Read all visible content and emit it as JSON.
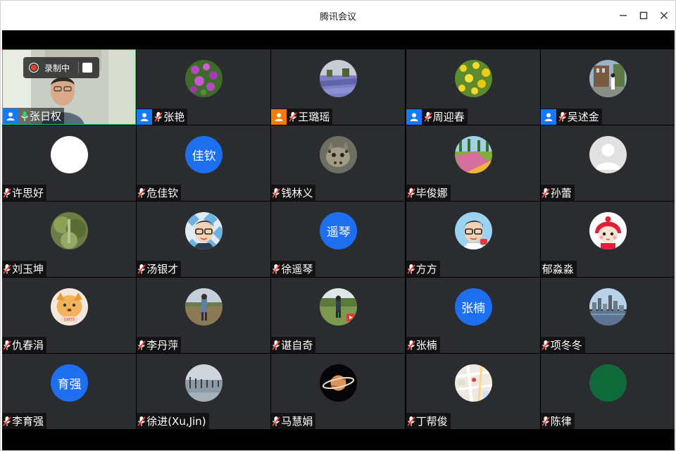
{
  "window": {
    "title": "腾讯会议",
    "controls": [
      "minimize-icon",
      "maximize-icon",
      "close-icon"
    ]
  },
  "recording": {
    "label": "录制中",
    "dot_color": "#ff3b30"
  },
  "colors": {
    "tile_bg": "#2b2c30",
    "role_blue": "#1677ff",
    "role_orange": "#f57c00",
    "text_avatar_blue": "#1d6ff0",
    "mic_muted_red": "#ff3b30",
    "mic_active_green": "#3bd16f",
    "local_border": "#2ecc71"
  },
  "participants": [
    {
      "name": "张日权",
      "mic": "active",
      "role": "blue",
      "avatar": "camera"
    },
    {
      "name": "张艳",
      "mic": "muted",
      "role": "blue",
      "avatar": "flowers-purple"
    },
    {
      "name": "王璐瑶",
      "mic": "muted",
      "role": "orange",
      "avatar": "lavender-field"
    },
    {
      "name": "周迎春",
      "mic": "muted",
      "role": "blue",
      "avatar": "yellow-flowers"
    },
    {
      "name": "吴述金",
      "mic": "muted",
      "role": "blue",
      "avatar": "person-building"
    },
    {
      "name": "许思好",
      "mic": "muted",
      "role": "",
      "avatar": "white-circle"
    },
    {
      "name": "危佳钦",
      "mic": "muted",
      "role": "",
      "avatar": "text",
      "avatar_text": "佳钦"
    },
    {
      "name": "钱林义",
      "mic": "muted",
      "role": "",
      "avatar": "leopard-cat"
    },
    {
      "name": "毕俊娜",
      "mic": "muted",
      "role": "",
      "avatar": "tulip-field"
    },
    {
      "name": "孙蕾",
      "mic": "muted",
      "role": "",
      "avatar": "default-person"
    },
    {
      "name": "刘玉坤",
      "mic": "muted",
      "role": "",
      "avatar": "green-blur"
    },
    {
      "name": "汤银才",
      "mic": "muted",
      "role": "",
      "avatar": "cartoon-glasses-man"
    },
    {
      "name": "徐遥琴",
      "mic": "muted",
      "role": "",
      "avatar": "text",
      "avatar_text": "遥琴"
    },
    {
      "name": "方方",
      "mic": "muted",
      "role": "",
      "avatar": "cartoon-glasses-man-2"
    },
    {
      "name": "郁淼淼",
      "mic": "none",
      "role": "",
      "avatar": "cartoon-girl-red-hat"
    },
    {
      "name": "仇春涓",
      "mic": "muted",
      "role": "",
      "avatar": "cartoon-dog"
    },
    {
      "name": "李丹萍",
      "mic": "muted",
      "role": "",
      "avatar": "person-field"
    },
    {
      "name": "谌自奇",
      "mic": "muted",
      "role": "",
      "avatar": "person-trees"
    },
    {
      "name": "张楠",
      "mic": "muted",
      "role": "",
      "avatar": "text",
      "avatar_text": "张楠"
    },
    {
      "name": "项冬冬",
      "mic": "muted",
      "role": "",
      "avatar": "city-skyline"
    },
    {
      "name": "李育强",
      "mic": "muted",
      "role": "",
      "avatar": "text",
      "avatar_text": "育强"
    },
    {
      "name": "徐进(Xu,Jin)",
      "mic": "muted",
      "role": "",
      "avatar": "water-posts"
    },
    {
      "name": "马慧娟",
      "mic": "muted",
      "role": "",
      "avatar": "saturn-planet"
    },
    {
      "name": "丁帮俊",
      "mic": "muted",
      "role": "",
      "avatar": "map"
    },
    {
      "name": "陈律",
      "mic": "muted",
      "role": "",
      "avatar": "green-circle"
    }
  ]
}
